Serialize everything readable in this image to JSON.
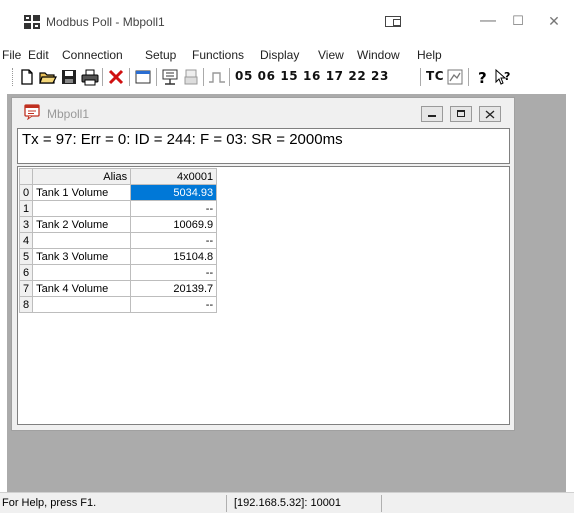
{
  "window": {
    "title": "Modbus Poll - Mbpoll1",
    "minimize_glyph": "—",
    "maximize_glyph": "☐",
    "close_glyph": "✕"
  },
  "menu": [
    "File",
    "Edit",
    "Connection",
    "Setup",
    "Functions",
    "Display",
    "View",
    "Window",
    "Help"
  ],
  "toolbar": {
    "function_codes": "05 06 15 16 17 22 23",
    "tc_label": "TC"
  },
  "child_window": {
    "title": "Mbpoll1",
    "status": "Tx = 97: Err = 0: ID = 244: F = 03: SR = 2000ms"
  },
  "table": {
    "headers": {
      "alias": "Alias",
      "value": "4x0001"
    },
    "rows": [
      {
        "n": "0",
        "alias": "Tank 1 Volume",
        "value": "5034.93",
        "selected": true
      },
      {
        "n": "1",
        "alias": "",
        "value": "--"
      },
      {
        "n": "3",
        "alias": "Tank 2 Volume",
        "value": "10069.9"
      },
      {
        "n": "4",
        "alias": "",
        "value": "--"
      },
      {
        "n": "5",
        "alias": "Tank 3 Volume",
        "value": "15104.8"
      },
      {
        "n": "6",
        "alias": "",
        "value": "--"
      },
      {
        "n": "7",
        "alias": "Tank 4 Volume",
        "value": "20139.7"
      },
      {
        "n": "8",
        "alias": "",
        "value": "--"
      }
    ]
  },
  "statusbar": {
    "help": "For Help, press F1.",
    "connection": "[192.168.5.32]: 10001"
  },
  "colors": {
    "selection": "#0078d7",
    "mdi_background": "#ababab"
  },
  "icons": [
    "app-icon",
    "new-file-icon",
    "open-folder-icon",
    "save-icon",
    "print-icon",
    "delete-icon",
    "window-icon",
    "connect-icon",
    "disconnect-icon",
    "pulse-icon",
    "chart-icon",
    "help-icon",
    "context-help-icon",
    "mbpoll-doc-icon"
  ]
}
